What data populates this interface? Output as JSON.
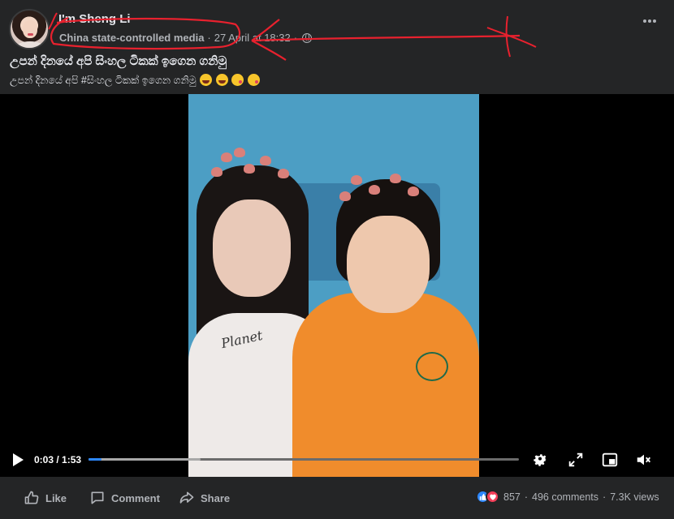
{
  "header": {
    "page_name": "I'm Sheng Li",
    "label": "China state-controlled media",
    "separator": "·",
    "timestamp": "27 April at 18:32",
    "separator2": "·",
    "audience_icon": "globe-icon"
  },
  "post": {
    "title": "උපන් දිනයේ අපි සිංහල ටිකක් ඉගෙන ගනිමු",
    "caption": "උපන් දිනයේ අපි #සිංහල ටිකක් ඉගෙන ගනිමු",
    "caption_emojis": [
      "grinning",
      "grinning",
      "kissing",
      "kissing"
    ]
  },
  "video": {
    "current_time": "0:03",
    "time_separator": " / ",
    "duration": "1:53",
    "played_fraction": 0.03,
    "buffered_fraction": 0.26,
    "shirt_text": "Planet",
    "controls": [
      "play-icon",
      "gear-icon",
      "fullscreen-icon",
      "pip-icon",
      "volume-muted-icon"
    ]
  },
  "footer": {
    "like_label": "Like",
    "comment_label": "Comment",
    "share_label": "Share",
    "reaction_count": "857",
    "dot": "·",
    "comments": "496 comments",
    "dot2": "·",
    "views": "7.3K views"
  },
  "colors": {
    "background": "#242526",
    "accent": "#2d88ff",
    "annotation": "#e8212e"
  }
}
